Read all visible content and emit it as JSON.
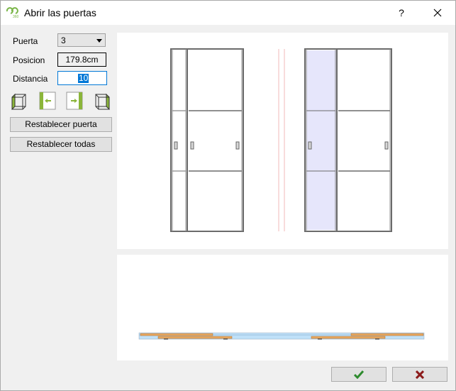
{
  "window": {
    "title": "Abrir las puertas",
    "help_label": "?",
    "close_label": "close"
  },
  "form": {
    "puerta_label": "Puerta",
    "puerta_value": "3",
    "posicion_label": "Posicion",
    "posicion_value": "179.8cm",
    "distancia_label": "Distancia",
    "distancia_value": "10"
  },
  "view_icons": [
    "cube-left-view-icon",
    "move-left-icon",
    "move-right-icon",
    "cube-right-view-icon"
  ],
  "buttons": {
    "reset_door": "Restablecer puerta",
    "reset_all": "Restablecer todas",
    "ok_icon": "check-icon",
    "cancel_icon": "x-icon"
  },
  "colors": {
    "accent_green": "#8bb53a",
    "selected_door_fill": "#e6e6fb",
    "ok_green": "#2e8b2e",
    "cancel_red": "#8b1a1a",
    "track_blue": "#bfe0f8",
    "panel_tan": "#e8a860"
  }
}
